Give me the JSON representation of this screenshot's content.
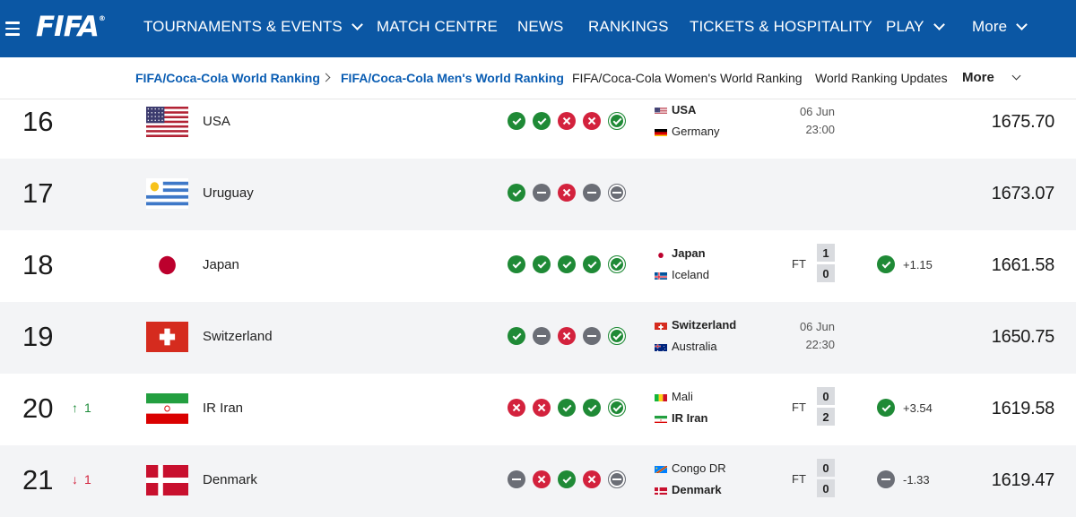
{
  "nav": {
    "logo": "FIFA",
    "logo_mark": "®",
    "items": [
      {
        "label": "TOURNAMENTS & EVENTS",
        "dropdown": true
      },
      {
        "label": "MATCH CENTRE",
        "dropdown": false
      },
      {
        "label": "NEWS",
        "dropdown": false
      },
      {
        "label": "RANKINGS",
        "dropdown": false
      },
      {
        "label": "TICKETS & HOSPITALITY",
        "dropdown": false
      },
      {
        "label": "PLAY",
        "dropdown": true
      },
      {
        "label": "More",
        "dropdown": true
      }
    ],
    "bg_color": "#0b57a4"
  },
  "subnav": {
    "breadcrumb": [
      "FIFA/Coca-Cola World Ranking",
      "FIFA/Coca-Cola Men's World Ranking"
    ],
    "links": [
      "FIFA/Coca-Cola Women's World Ranking",
      "World Ranking Updates"
    ],
    "more": "More"
  },
  "rows": [
    {
      "rank": "16",
      "movement": null,
      "flag": "usa",
      "team": "USA",
      "form": [
        "w",
        "w",
        "l",
        "l",
        "w-ring"
      ],
      "match": {
        "home": "USA",
        "home_flag": "usa",
        "home_bold": true,
        "away": "Germany",
        "away_flag": "germany",
        "away_bold": false,
        "date": "06 Jun",
        "time": "23:00"
      },
      "points": "1675.70"
    },
    {
      "rank": "17",
      "movement": null,
      "flag": "uruguay",
      "team": "Uruguay",
      "form": [
        "w",
        "d",
        "l",
        "d",
        "d-ring"
      ],
      "match": null,
      "points": "1673.07"
    },
    {
      "rank": "18",
      "movement": null,
      "flag": "japan",
      "team": "Japan",
      "form": [
        "w",
        "w",
        "w",
        "w",
        "w-ring"
      ],
      "match": {
        "home": "Japan",
        "home_flag": "japan",
        "home_bold": true,
        "away": "Iceland",
        "away_flag": "iceland",
        "away_bold": false,
        "status": "FT",
        "home_score": "1",
        "away_score": "0"
      },
      "result": {
        "icon": "w",
        "delta": "+1.15"
      },
      "points": "1661.58"
    },
    {
      "rank": "19",
      "movement": null,
      "flag": "switzerland",
      "team": "Switzerland",
      "form": [
        "w",
        "d",
        "l",
        "d",
        "w-ring"
      ],
      "match": {
        "home": "Switzerland",
        "home_flag": "switzerland",
        "home_bold": true,
        "away": "Australia",
        "away_flag": "australia",
        "away_bold": false,
        "date": "06 Jun",
        "time": "22:30"
      },
      "points": "1650.75"
    },
    {
      "rank": "20",
      "movement": {
        "dir": "up",
        "value": "1"
      },
      "flag": "iran",
      "team": "IR Iran",
      "form": [
        "l",
        "l",
        "w",
        "w",
        "w-ring"
      ],
      "match": {
        "home": "Mali",
        "home_flag": "mali",
        "home_bold": false,
        "away": "IR Iran",
        "away_flag": "iran",
        "away_bold": true,
        "status": "FT",
        "home_score": "0",
        "away_score": "2"
      },
      "result": {
        "icon": "w",
        "delta": "+3.54"
      },
      "points": "1619.58"
    },
    {
      "rank": "21",
      "movement": {
        "dir": "down",
        "value": "1"
      },
      "flag": "denmark",
      "team": "Denmark",
      "form": [
        "d",
        "l",
        "w",
        "l",
        "d-ring"
      ],
      "match": {
        "home": "Congo DR",
        "home_flag": "congo",
        "home_bold": false,
        "away": "Denmark",
        "away_flag": "denmark",
        "away_bold": true,
        "status": "FT",
        "home_score": "0",
        "away_score": "0"
      },
      "result": {
        "icon": "d",
        "delta": "-1.33"
      },
      "points": "1619.47"
    }
  ]
}
